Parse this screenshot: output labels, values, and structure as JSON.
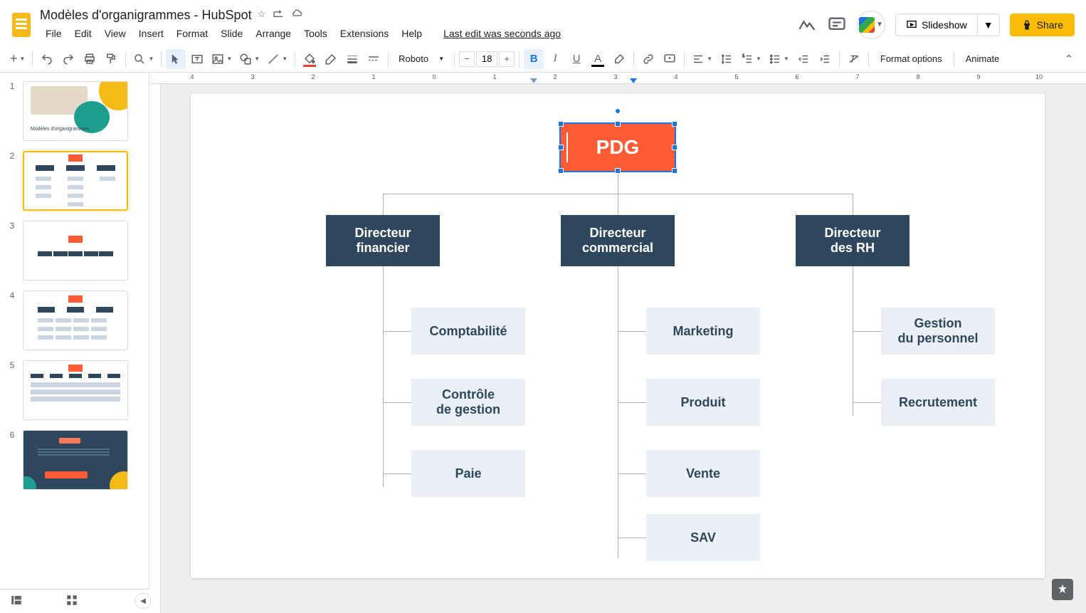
{
  "doc": {
    "title": "Modèles d'organigrammes - HubSpot",
    "edit_status": "Last edit was seconds ago"
  },
  "menu": {
    "file": "File",
    "edit": "Edit",
    "view": "View",
    "insert": "Insert",
    "format": "Format",
    "slide": "Slide",
    "arrange": "Arrange",
    "tools": "Tools",
    "extensions": "Extensions",
    "help": "Help"
  },
  "actions": {
    "slideshow": "Slideshow",
    "share": "Share"
  },
  "toolbar": {
    "font": "Roboto",
    "size": "18",
    "format_options": "Format options",
    "animate": "Animate"
  },
  "slides": {
    "s1": {
      "title": "Modèles d'organigrammes"
    },
    "numbers": [
      "1",
      "2",
      "3",
      "4",
      "5",
      "6"
    ]
  },
  "chart_data": {
    "type": "tree",
    "root": {
      "label": "PDG",
      "color": "#ff5c35"
    },
    "directors": [
      {
        "key": "fin",
        "label": "Directeur\nfinancier",
        "children": [
          "Comptabilité",
          "Contrôle\nde gestion",
          "Paie"
        ]
      },
      {
        "key": "comm",
        "label": "Directeur\ncommercial",
        "children": [
          "Marketing",
          "Produit",
          "Vente",
          "SAV"
        ]
      },
      {
        "key": "rh",
        "label": "Directeur\ndes RH",
        "children": [
          "Gestion\ndu personnel",
          "Recrutement"
        ]
      }
    ]
  }
}
